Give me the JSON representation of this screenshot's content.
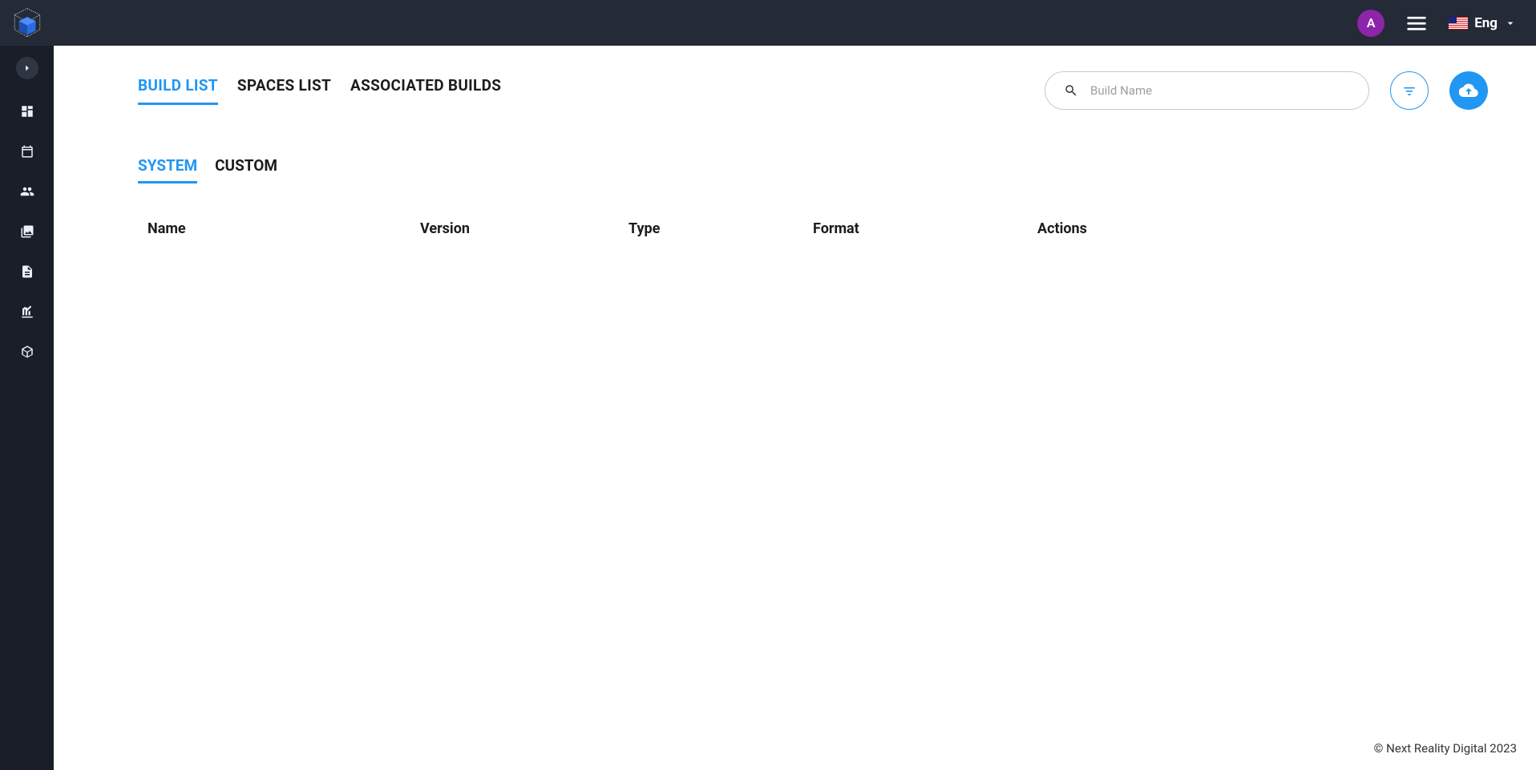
{
  "header": {
    "avatar_initial": "A",
    "lang_label": "Eng"
  },
  "sidebar": {
    "items": [
      {
        "name": "dashboard"
      },
      {
        "name": "calendar"
      },
      {
        "name": "users"
      },
      {
        "name": "images"
      },
      {
        "name": "document"
      },
      {
        "name": "analytics"
      },
      {
        "name": "package"
      }
    ]
  },
  "tabs": {
    "main": [
      {
        "label": "BUILD LIST",
        "active": true
      },
      {
        "label": "SPACES LIST",
        "active": false
      },
      {
        "label": "ASSOCIATED BUILDS",
        "active": false
      }
    ],
    "sub": [
      {
        "label": "SYSTEM",
        "active": true
      },
      {
        "label": "CUSTOM",
        "active": false
      }
    ]
  },
  "search": {
    "placeholder": "Build Name",
    "value": ""
  },
  "table": {
    "columns": [
      "Name",
      "Version",
      "Type",
      "Format",
      "Actions"
    ],
    "rows": []
  },
  "footer": {
    "copyright": "© Next Reality Digital 2023"
  },
  "colors": {
    "accent": "#2196f3",
    "header_bg": "#252a37",
    "sidebar_bg": "#1a1e29",
    "avatar_bg": "#8e24aa"
  }
}
